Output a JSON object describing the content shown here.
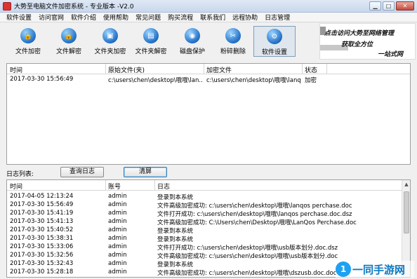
{
  "window": {
    "title": "大势至电脑文件加密系统 - 专业版本 -V2.0"
  },
  "menu": [
    "软件设置",
    "访问官网",
    "软件介绍",
    "使用帮助",
    "常见问题",
    "购买流程",
    "联系我们",
    "远程协助",
    "日志管理"
  ],
  "toolbar": [
    {
      "label": "文件加密",
      "icon": "file-encrypt-icon"
    },
    {
      "label": "文件解密",
      "icon": "file-decrypt-icon"
    },
    {
      "label": "文件夹加密",
      "icon": "folder-encrypt-icon"
    },
    {
      "label": "文件夹解密",
      "icon": "folder-decrypt-icon"
    },
    {
      "label": "磁盘保护",
      "icon": "disk-protect-icon"
    },
    {
      "label": "粉碎删除",
      "icon": "shred-delete-icon"
    },
    {
      "label": "软件设置",
      "icon": "settings-icon"
    }
  ],
  "banner": {
    "line1": "点击访问大势至网络管理",
    "line2": "获取全方位",
    "line3": "一站式网"
  },
  "encrypted_table": {
    "headers": [
      "时间",
      "原始文件(夹)",
      "加密文件",
      "状态"
    ],
    "rows": [
      [
        "2017-03-30 15:56:49",
        "c:\\users\\chen\\desktop\\哦哦\\lan...",
        "c:\\users\\chen\\desktop\\哦哦\\lanqo...",
        "加密"
      ]
    ]
  },
  "log": {
    "label": "日志列表:",
    "query_button": "查询日志",
    "clear_button": "清屏"
  },
  "log_table": {
    "headers": [
      "时间",
      "账号",
      "日志"
    ],
    "rows": [
      [
        "2017-04-05 12:13:24",
        "admin",
        "登录到本系统"
      ],
      [
        "2017-03-30 15:56:49",
        "admin",
        "文件高级加密成功: c:\\users\\chen\\desktop\\哦哦\\lanqos perchase.doc"
      ],
      [
        "2017-03-30 15:41:19",
        "admin",
        "文件打开成功: c:\\users\\chen\\desktop\\哦哦\\lanqos perchase.doc.dsz"
      ],
      [
        "2017-03-30 15:41:13",
        "admin",
        "文件高级加密成功: C:\\Users\\chen\\Desktop\\哦哦\\LanQos Perchase.doc"
      ],
      [
        "2017-03-30 15:40:52",
        "admin",
        "登录到本系统"
      ],
      [
        "2017-03-30 15:38:31",
        "admin",
        "登录到本系统"
      ],
      [
        "2017-03-30 15:33:06",
        "admin",
        "文件打开成功: c:\\users\\chen\\desktop\\哦哦\\usb版本划分.doc.dsz"
      ],
      [
        "2017-03-30 15:32:56",
        "admin",
        "文件高级加密成功: c:\\users\\chen\\desktop\\哦哦\\usb版本划分.doc"
      ],
      [
        "2017-03-30 15:32:43",
        "admin",
        "登录到本系统"
      ],
      [
        "2017-03-30 15:28:18",
        "admin",
        "文件高级加密成功: c:\\users\\chen\\desktop\\哦哦\\dszusb.doc.doc"
      ]
    ]
  },
  "watermark": {
    "text": "一同手游网",
    "badge": "1"
  }
}
